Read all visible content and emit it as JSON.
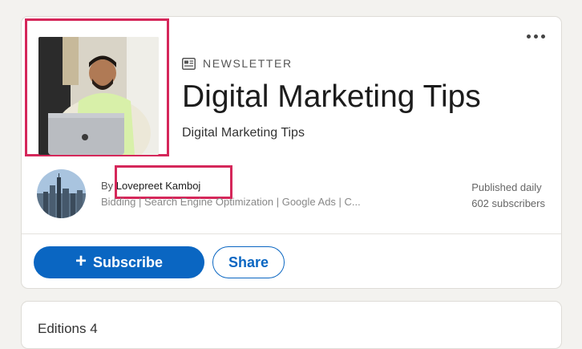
{
  "newsletter": {
    "kicker": "NEWSLETTER",
    "kicker_icon": "newspaper-icon",
    "title": "Digital Marketing Tips",
    "subtitle": "Digital Marketing Tips"
  },
  "author": {
    "by_prefix": "By",
    "name": "Lovepreet Kamboj",
    "headline": "Bidding | Search Engine Optimization | Google Ads | C..."
  },
  "meta": {
    "frequency": "Published daily",
    "subscribers": "602 subscribers"
  },
  "actions": {
    "subscribe_label": "Subscribe",
    "share_label": "Share",
    "more_icon": "more-horizontal-icon"
  },
  "editions": {
    "label": "Editions 4"
  },
  "colors": {
    "accent": "#0a66c2",
    "highlight": "#d5275a",
    "page_background": "#f3f2ef"
  }
}
